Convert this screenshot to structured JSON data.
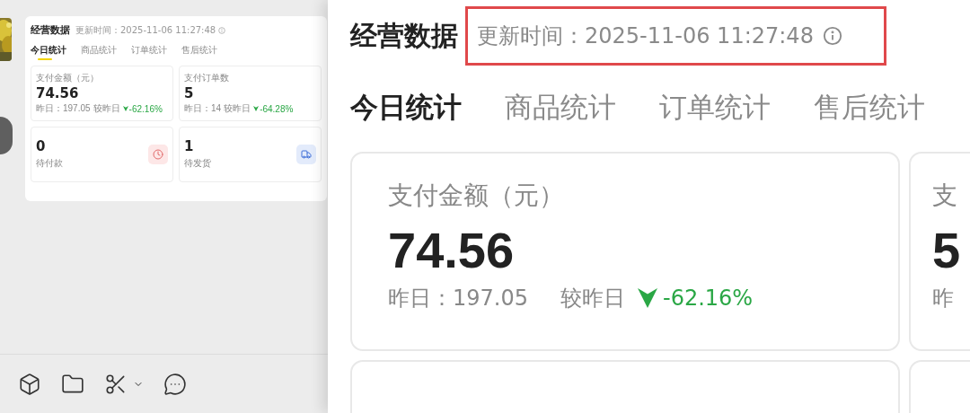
{
  "app": {
    "toolbar": [
      {
        "kind": "cube",
        "menu": false
      },
      {
        "kind": "folder",
        "menu": false
      },
      {
        "kind": "scissors",
        "menu": true
      },
      {
        "kind": "chat",
        "menu": false
      }
    ],
    "dashboard": {
      "title": "经营数据",
      "update_time": "更新时间：2025-11-06 11:27:48",
      "tabs": [
        {
          "label": "今日统计",
          "selected": true
        },
        {
          "label": "商品统计",
          "selected": false
        },
        {
          "label": "订单统计",
          "selected": false
        },
        {
          "label": "售后统计",
          "selected": false
        }
      ],
      "metrics": [
        {
          "label": "支付金额（元）",
          "value": "74.56",
          "yesterday": "昨日：197.05",
          "compare_label": "较昨日",
          "change": "-62.16%"
        },
        {
          "label": "支付订单数",
          "value": "5",
          "yesterday": "昨日：14",
          "compare_label": "较昨日",
          "change": "-64.28%"
        }
      ],
      "tasks": [
        {
          "value": "0",
          "label": "待付款",
          "kind": "clock"
        },
        {
          "value": "1",
          "label": "待发货",
          "kind": "truck"
        }
      ]
    }
  },
  "zoom": {
    "title": "经营数据",
    "update_time": "更新时间：2025-11-06 11:27:48",
    "highlighted": true,
    "tabs": [
      {
        "label": "今日统计",
        "selected": true
      },
      {
        "label": "商品统计",
        "selected": false
      },
      {
        "label": "订单统计",
        "selected": false
      },
      {
        "label": "售后统计",
        "selected": false
      }
    ],
    "metrics": [
      {
        "label": "支付金额（元）",
        "value": "74.56",
        "yesterday": "昨日：197.05",
        "compare_label": "较昨日",
        "change": "-62.16%"
      },
      {
        "label": "支",
        "value": "5",
        "yesterday": "昨"
      }
    ]
  }
}
